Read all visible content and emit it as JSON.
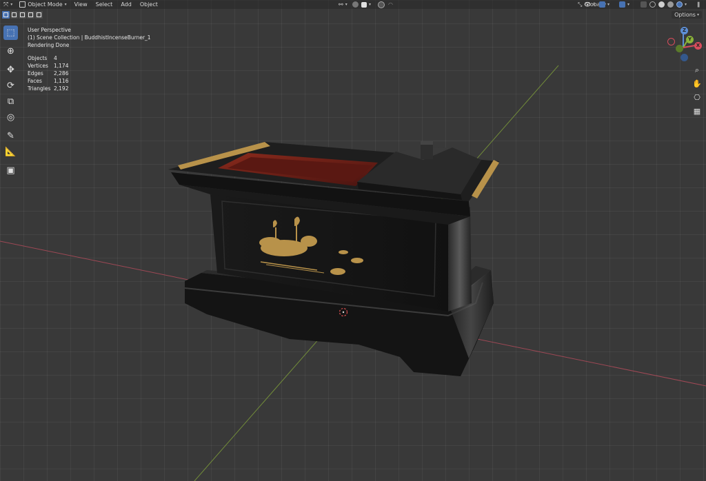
{
  "header": {
    "mode": "Object Mode",
    "menus": [
      "View",
      "Select",
      "Add",
      "Object"
    ],
    "transform_orientation": "Global",
    "options_label": "Options"
  },
  "overlay": {
    "view_name": "User Perspective",
    "collection_path": "(1) Scene Collection | BuddhistIncenseBurner_1",
    "status": "Rendering Done",
    "stats": [
      {
        "label": "Objects",
        "value": "4"
      },
      {
        "label": "Vertices",
        "value": "1,174"
      },
      {
        "label": "Edges",
        "value": "2,286"
      },
      {
        "label": "Faces",
        "value": "1,116"
      },
      {
        "label": "Triangles",
        "value": "2,192"
      }
    ]
  },
  "gizmo": {
    "x_label": "X",
    "y_label": "Y",
    "z_label": "Z"
  },
  "toolbar": {
    "tools": [
      "select-box-icon",
      "cursor-icon",
      "move-icon",
      "rotate-icon",
      "scale-icon",
      "transform-icon",
      "annotate-icon",
      "measure-icon",
      "add-cube-icon"
    ]
  },
  "colors": {
    "x_axis": "#b04b5a",
    "y_axis": "#7c9b3a",
    "accent": "#4772b3",
    "lacquer": "#1b1b1b",
    "gold": "#b8924a",
    "red_interior": "#7a2418"
  }
}
